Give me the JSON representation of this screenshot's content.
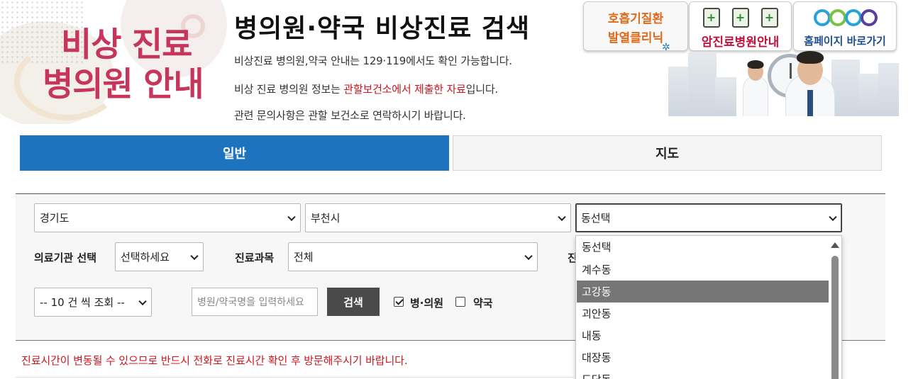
{
  "header": {
    "hero_line1": "비상 진료",
    "hero_line2": "병의원 안내",
    "title": "병의원·약국 비상진료 검색",
    "info1": "비상진료 병의원,약국 안내는 129·119에서도 확인 가능합니다.",
    "info2_pre": "비상 진료 병의원 정보는 ",
    "info2_red": "관할보건소에서 제출한 자료",
    "info2_post": "입니다.",
    "info3": "관련 문의사항은 관할 보건소로 연락하시기 바랍니다."
  },
  "banners": {
    "respiratory_line1": "호흡기질환",
    "respiratory_line2": "발열클리닉",
    "cancer": "암진료병원안내",
    "homepage": "홈페이지 바로가기"
  },
  "tabs": {
    "general": "일반",
    "map": "지도"
  },
  "search": {
    "province": "경기도",
    "city": "부천시",
    "dong": "동선택",
    "institution_label": "의료기관 선택",
    "institution_value": "선택하세요",
    "department_label": "진료과목",
    "department_value": "전체",
    "clipped_label_char": "진",
    "page_size": "-- 10 건 씩 조회 --",
    "name_placeholder": "병원/약국명을 입력하세요",
    "search_button": "검색",
    "check_hospital": "병·의원",
    "check_pharmacy": "약국",
    "check_hospital_checked": true,
    "check_pharmacy_checked": false
  },
  "dong_dropdown": {
    "options": [
      "동선택",
      "계수동",
      "고강동",
      "괴안동",
      "내동",
      "대장동",
      "도당동"
    ],
    "highlighted_index": 2
  },
  "notice": "진료시간이 변동될 수 있으므로 반드시 전화로 진료시간 확인 후 방문해주시기 바랍니다.",
  "colors": {
    "primary_blue": "#1e73be",
    "accent_red": "#d0141c",
    "hero_pink": "#c6355a"
  }
}
